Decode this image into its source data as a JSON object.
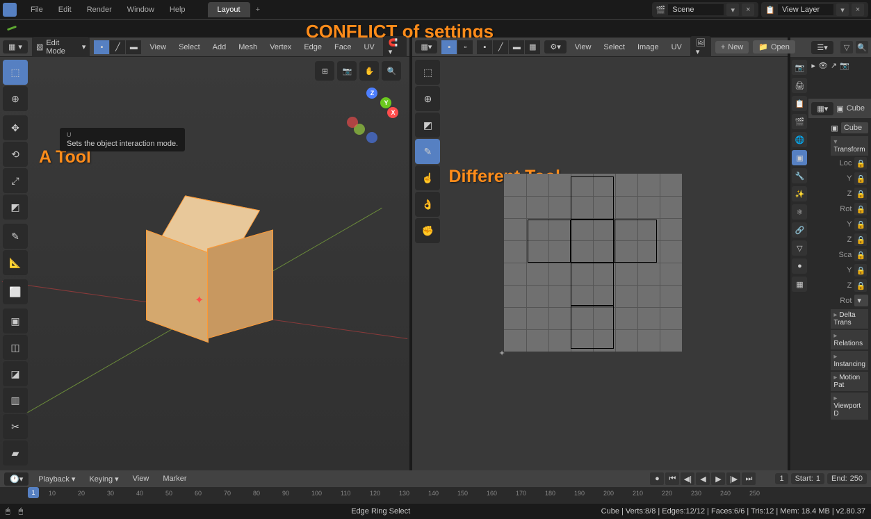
{
  "topbar": {
    "menus": [
      "File",
      "Edit",
      "Render",
      "Window",
      "Help"
    ],
    "workspace_active": "Layout",
    "scene_label": "Scene",
    "viewlayer_label": "View Layer"
  },
  "annotations": {
    "conflict": "CONFLICT  of  settings",
    "a_tool": "A  Tool",
    "different_tool": "Different  Tool"
  },
  "tooltip": {
    "text": "Sets the object interaction mode.",
    "prefix": "U"
  },
  "viewport3d": {
    "mode": "Edit Mode",
    "menus": [
      "View",
      "Select",
      "Add",
      "Mesh",
      "Vertex",
      "Edge",
      "Face",
      "UV"
    ],
    "axes": {
      "x": "X",
      "y": "Y",
      "z": "Z"
    }
  },
  "uv_editor": {
    "menus": [
      "View",
      "Select",
      "Image",
      "UV"
    ],
    "new_btn": "New",
    "open_btn": "Open"
  },
  "properties": {
    "object_name": "Cube",
    "item_name": "Cube",
    "transform_header": "Transform",
    "loc_label": "Loc",
    "rot_label": "Rot",
    "sca_label": "Sca",
    "rot_mode_label": "Rot",
    "axes": [
      "Y",
      "Z"
    ],
    "panels": [
      "Delta Trans",
      "Relations",
      "Instancing",
      "Motion Pat",
      "Viewport D"
    ]
  },
  "timeline": {
    "playback": "Playback",
    "keying": "Keying",
    "view": "View",
    "marker": "Marker",
    "current_frame": "1",
    "start_label": "Start:",
    "start_value": "1",
    "end_label": "End:",
    "end_value": "250",
    "ticks": [
      "10",
      "20",
      "30",
      "40",
      "50",
      "60",
      "70",
      "80",
      "90",
      "100",
      "110",
      "120",
      "130",
      "140",
      "150",
      "160",
      "170",
      "180",
      "190",
      "200",
      "210",
      "220",
      "230",
      "240",
      "250"
    ]
  },
  "statusbar": {
    "tool": "Edge Ring Select",
    "stats": "Cube | Verts:8/8 | Edges:12/12 | Faces:6/6 | Tris:12 | Mem: 18.4 MB | v2.80.37"
  }
}
